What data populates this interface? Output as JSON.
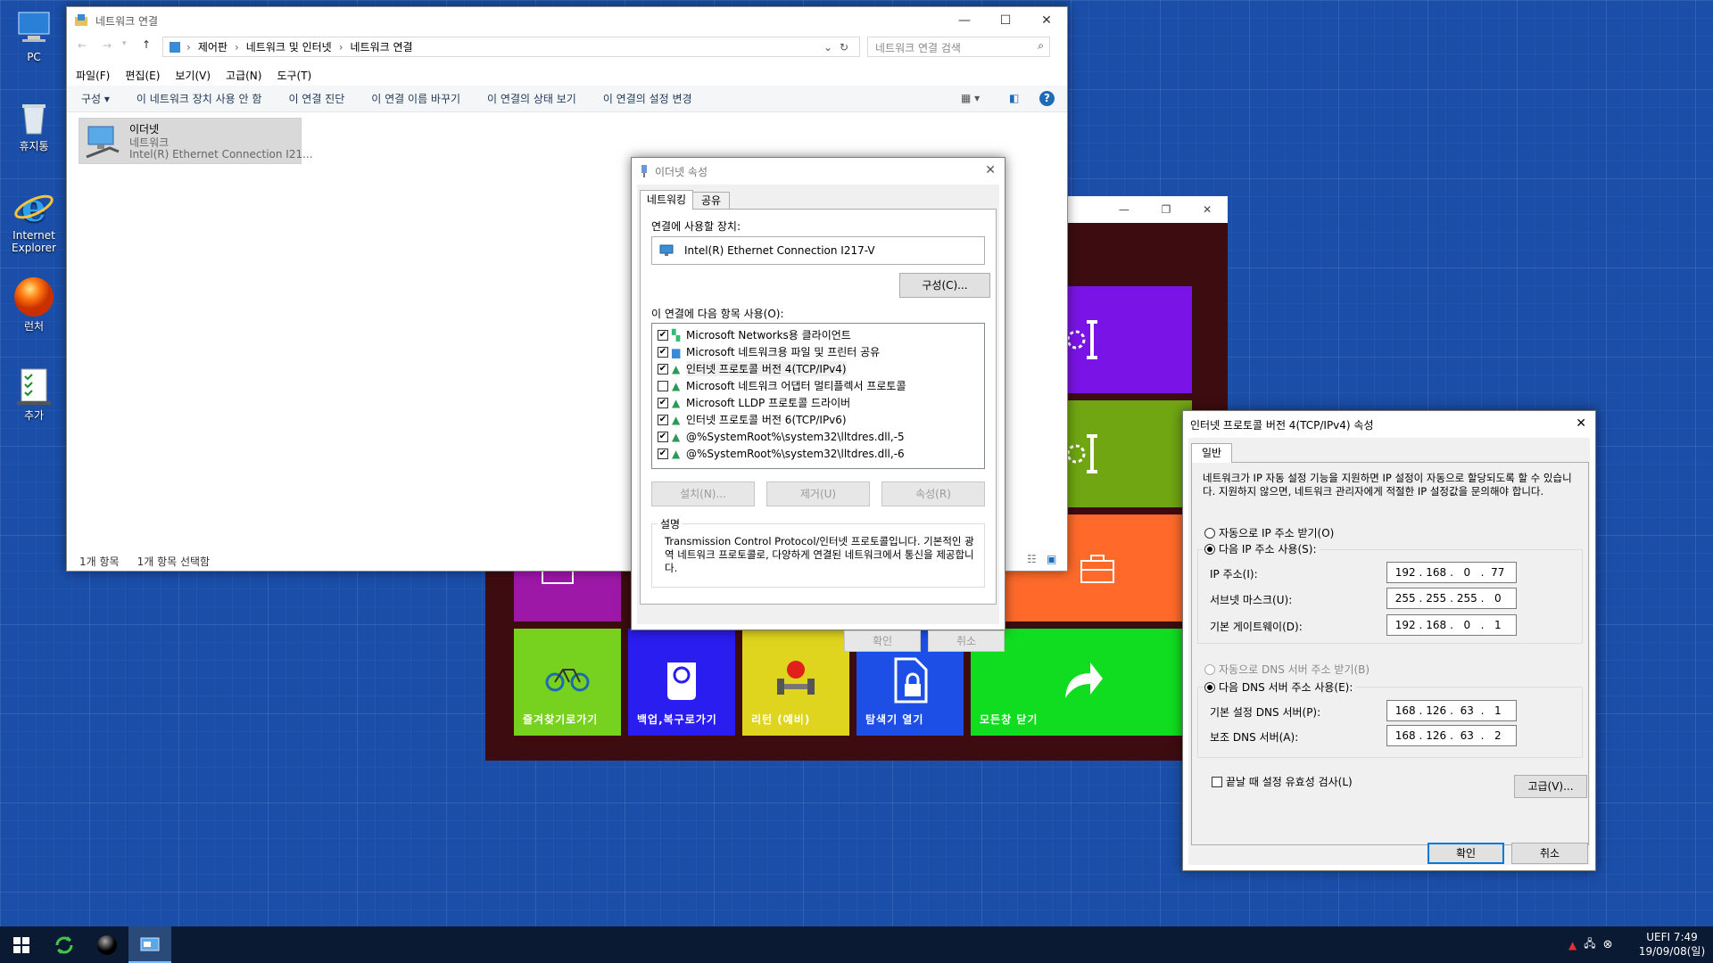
{
  "desktop": {
    "icons": [
      {
        "label": "PC",
        "icon": "computer-icon"
      },
      {
        "label": "휴지통",
        "icon": "recycle-bin-icon"
      },
      {
        "label": "Internet Explorer",
        "icon": "internet-explorer-icon"
      },
      {
        "label": "런처",
        "icon": "launcher-orb-icon"
      },
      {
        "label": "추가",
        "icon": "checklist-icon"
      }
    ]
  },
  "explorer": {
    "title": "네트워크 연결",
    "breadcrumb": [
      "제어판",
      "네트워크 및 인터넷",
      "네트워크 연결"
    ],
    "search_placeholder": "네트워크 연결 검색",
    "menu": [
      "파일(F)",
      "편집(E)",
      "보기(V)",
      "고급(N)",
      "도구(T)"
    ],
    "commands": [
      "구성 ▾",
      "이 네트워크 장치 사용 안 함",
      "이 연결 진단",
      "이 연결 이름 바꾸기",
      "이 연결의 상태 보기",
      "이 연결의 설정 변경"
    ],
    "item": {
      "name": "이더넷",
      "type": "네트워크",
      "device": "Intel(R) Ethernet Connection I21..."
    },
    "status": {
      "count": "1개 항목",
      "selected": "1개 항목 선택함"
    }
  },
  "ethernet_props": {
    "title": "이더넷 속성",
    "tabs": [
      "네트워킹",
      "공유"
    ],
    "connect_using_label": "연결에 사용할 장치:",
    "device": "Intel(R) Ethernet Connection I217-V",
    "configure_button": "구성(C)...",
    "items_label": "이 연결에 다음 항목 사용(O):",
    "items": [
      {
        "label": "Microsoft Networks용 클라이언트",
        "checked": true
      },
      {
        "label": "Microsoft 네트워크용 파일 및 프린터 공유",
        "checked": true
      },
      {
        "label": "인터넷 프로토콜 버전 4(TCP/IPv4)",
        "checked": true
      },
      {
        "label": "Microsoft 네트워크 어댑터 멀티플렉서 프로토콜",
        "checked": false
      },
      {
        "label": "Microsoft LLDP 프로토콜 드라이버",
        "checked": true
      },
      {
        "label": "인터넷 프로토콜 버전 6(TCP/IPv6)",
        "checked": true
      },
      {
        "label": "@%SystemRoot%\\system32\\lltdres.dll,-5",
        "checked": true
      },
      {
        "label": "@%SystemRoot%\\system32\\lltdres.dll,-6",
        "checked": true
      }
    ],
    "install_button": "설치(N)...",
    "uninstall_button": "제거(U)",
    "properties_button": "속성(R)",
    "description_label": "설명",
    "description": "Transmission Control Protocol/인터넷 프로토콜입니다. 기본적인 광역 네트워크 프로토콜로, 다양하게 연결된 네트워크에서 통신을 제공합니다.",
    "ok_button": "확인",
    "cancel_button": "취소"
  },
  "ipv4_props": {
    "title": "인터넷 프로토콜 버전 4(TCP/IPv4) 속성",
    "tab": "일반",
    "intro": "네트워크가 IP 자동 설정 기능을 지원하면 IP 설정이 자동으로 할당되도록 할 수 있습니다. 지원하지 않으면, 네트워크 관리자에게 적절한 IP 설정값을 문의해야 합니다.",
    "auto_ip": "자동으로 IP 주소 받기(O)",
    "manual_ip": "다음 IP 주소 사용(S):",
    "ip_label": "IP 주소(I):",
    "ip": [
      "192",
      "168",
      "0",
      "77"
    ],
    "mask_label": "서브넷 마스크(U):",
    "mask": [
      "255",
      "255",
      "255",
      "0"
    ],
    "gateway_label": "기본 게이트웨이(D):",
    "gateway": [
      "192",
      "168",
      "0",
      "1"
    ],
    "auto_dns": "자동으로 DNS 서버 주소 받기(B)",
    "manual_dns": "다음 DNS 서버 주소 사용(E):",
    "dns1_label": "기본 설정 DNS 서버(P):",
    "dns1": [
      "168",
      "126",
      "63",
      "1"
    ],
    "dns2_label": "보조 DNS 서버(A):",
    "dns2": [
      "168",
      "126",
      "63",
      "2"
    ],
    "validate_label": "끝날 때 설정 유효성 검사(L)",
    "advanced_button": "고급(V)...",
    "ok_button": "확인",
    "cancel_button": "취소"
  },
  "launcher": {
    "tiles": [
      {
        "label": "즐겨찾기로가기",
        "color": "#77d11f",
        "icon": "bicycle-icon"
      },
      {
        "label": "백업,복구로가기",
        "color": "#2a1df0",
        "icon": "backup-drive-icon"
      },
      {
        "label": "리턴 (예비)",
        "color": "#dfd51e",
        "icon": "dumbbell-apple-icon"
      },
      {
        "label": "탐색기 열기",
        "color": "#1d4fe6",
        "icon": "locked-file-icon"
      },
      {
        "label": "모든창 닫기",
        "color": "#10dc20",
        "icon": "share-arrow-icon"
      }
    ],
    "side_colors": [
      "#7a14e6",
      "#6fa612",
      "#ff6a2b",
      "#9e18a8"
    ],
    "bg": "#3d0c10"
  },
  "taskbar": {
    "clock_line1": "UEFI 7:49",
    "clock_line2": "19/09/08(일)"
  }
}
